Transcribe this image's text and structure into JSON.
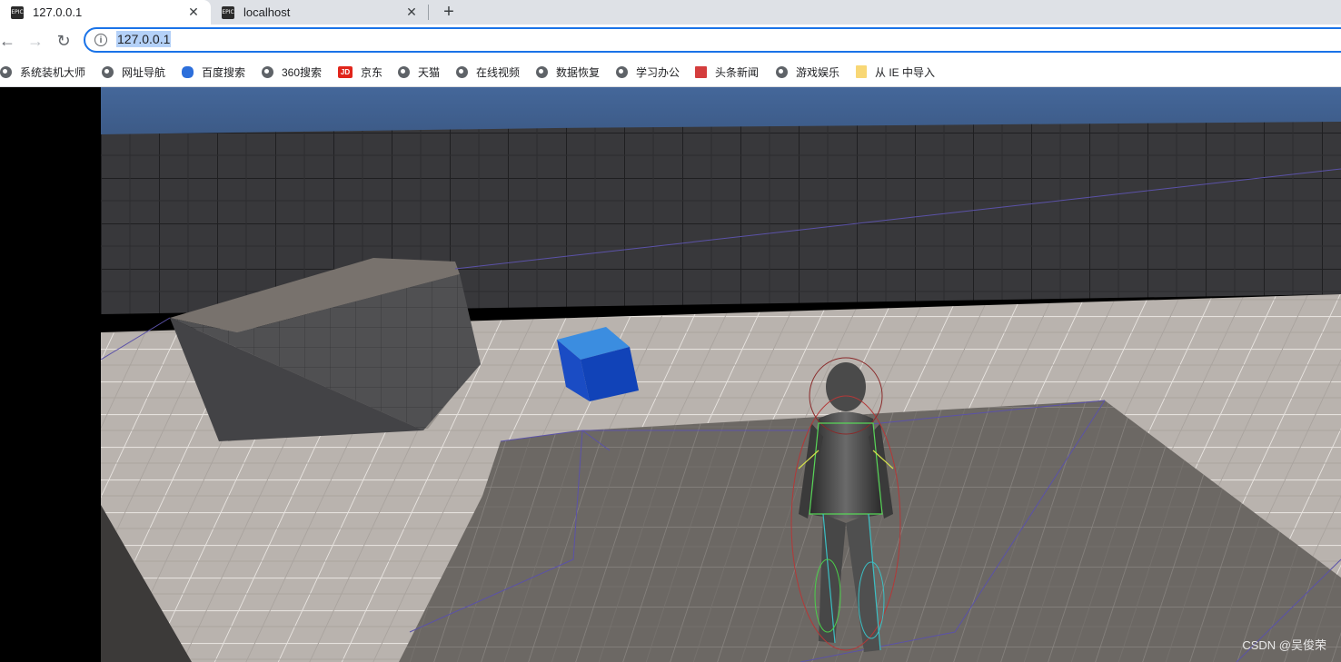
{
  "tabs": [
    {
      "title": "127.0.0.1",
      "favicon": "epic-games-icon",
      "close": "✕"
    },
    {
      "title": "localhost",
      "favicon": "epic-games-icon",
      "close": "✕"
    }
  ],
  "new_tab": "+",
  "nav": {
    "back": "←",
    "forward": "→",
    "reload": "↻"
  },
  "address_bar": {
    "info_icon": "i",
    "url": "127.0.0.1"
  },
  "bookmarks": [
    {
      "label": "系统装机大师",
      "icon": "globe"
    },
    {
      "label": "网址导航",
      "icon": "globe"
    },
    {
      "label": "百度搜索",
      "icon": "paw"
    },
    {
      "label": "360搜索",
      "icon": "globe"
    },
    {
      "label": "京东",
      "icon": "jd"
    },
    {
      "label": "天猫",
      "icon": "globe"
    },
    {
      "label": "在线视频",
      "icon": "globe"
    },
    {
      "label": "数据恢复",
      "icon": "globe"
    },
    {
      "label": "学习办公",
      "icon": "globe"
    },
    {
      "label": "头条新闻",
      "icon": "toutiao"
    },
    {
      "label": "游戏娱乐",
      "icon": "globe"
    },
    {
      "label": "从 IE 中导入",
      "icon": "folder"
    }
  ],
  "jd_badge": "JD",
  "epic_badge": "EPIC",
  "watermark": "CSDN @吴俊荣"
}
